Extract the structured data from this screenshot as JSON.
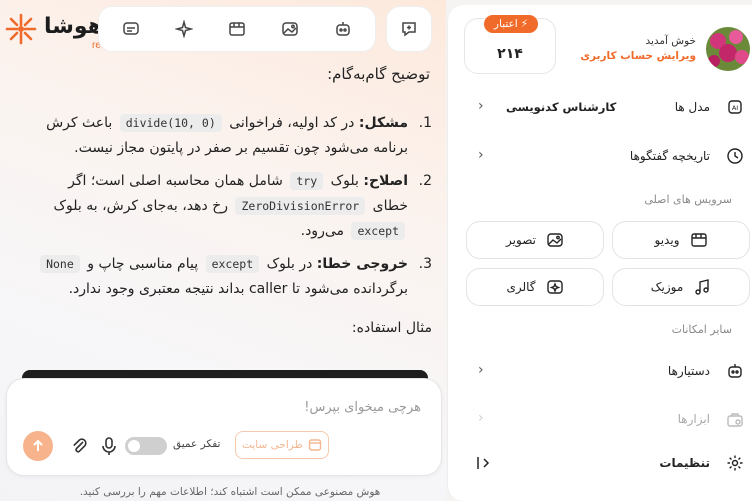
{
  "brand": {
    "name": "هوشا",
    "sub": "ret"
  },
  "toolbar": {
    "items": [
      "chat-icon",
      "sparkle-icon",
      "film-icon",
      "image-icon",
      "robot-icon"
    ],
    "new_chat": "new-chat-icon"
  },
  "content": {
    "heading": "توضیح گام‌به‌گام:",
    "items": [
      {
        "num": "1.",
        "label": "مشکل:",
        "t1": "در کد اولیه، فراخوانی",
        "c1": "divide(10, 0)",
        "t2": "باعث کرش برنامه می‌شود چون تقسیم بر صفر در پایتون مجاز نیست."
      },
      {
        "num": "2.",
        "label": "اصلاح:",
        "t1": "بلوک",
        "c1": "try",
        "t2": "شامل همان محاسبه اصلی است؛ اگر خطای",
        "c2": "ZeroDivisionError",
        "t3": "رخ دهد، به‌جای کرش، به بلوک",
        "c3": "except",
        "t4": "می‌رود."
      },
      {
        "num": "3.",
        "label": "خروجی خطا:",
        "t1": "در بلوک",
        "c1": "except",
        "t2": "پیام مناسبی چاپ و",
        "c2": "None",
        "t3": "برگردانده می‌شود تا caller بداند نتیجه معتبری وجود ندارد."
      }
    ],
    "example_label": "مثال استفاده:"
  },
  "composer": {
    "placeholder": "هرچی میخوای بپرس!",
    "deep_thinking_label": "تفکر عمیق",
    "deep_thinking_on": false,
    "site_design_label": "طراحی سایت"
  },
  "disclaimer": "هوش مصنوعی ممکن است اشتباه کند؛ اطلاعات مهم را بررسی کنید.",
  "sidebar": {
    "welcome": "خوش آمدید",
    "edit_profile": "ویرایش حساب کاربری",
    "credit": {
      "label": "اعتبار",
      "value": "۲۱۴"
    },
    "models_label": "مدل ها",
    "models_value": "کارشناس کدنویسی",
    "history_label": "تاریخچه گفتگوها",
    "main_services_title": "سرویس های اصلی",
    "services": {
      "video": "ویدیو",
      "image": "تصویر",
      "music": "موزیک",
      "gallery": "گالری"
    },
    "other_title": "سایر امکانات",
    "assistants": "دستیارها",
    "tools": "ابزارها",
    "settings": "تنظیمات"
  },
  "colors": {
    "accent": "#f06a2a",
    "accent_light": "#f7b48c"
  }
}
